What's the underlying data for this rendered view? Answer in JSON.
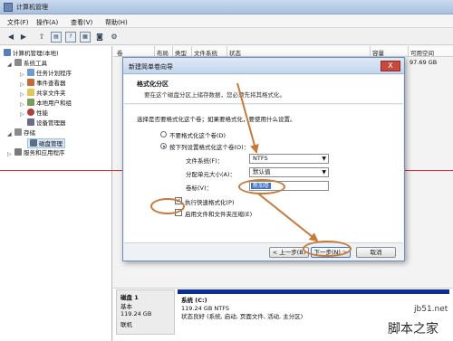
{
  "window": {
    "title": "计算机管理"
  },
  "menu": [
    "文件(F)",
    "操作(A)",
    "查看(V)",
    "帮助(H)"
  ],
  "tree": {
    "root": "计算机管理(本地)",
    "system_tools": "系统工具",
    "task_scheduler": "任务计划程序",
    "event_viewer": "事件查看器",
    "shared_folders": "共享文件夹",
    "local_users": "本地用户和组",
    "performance": "性能",
    "device_manager": "设备管理器",
    "storage": "存储",
    "disk_management": "磁盘管理",
    "services": "服务和应用程序"
  },
  "columns": [
    "卷",
    "布局",
    "类型",
    "文件系统",
    "状态",
    "容量",
    "可用空间"
  ],
  "capacity_value": "97.69 GB",
  "dialog": {
    "title": "新建简单卷向导",
    "close": "X",
    "header_title": "格式化分区",
    "header_sub": "要在这个磁盘分区上储存数据，您必须先将其格式化。",
    "prompt": "选择是否要格式化这个卷；如果要格式化，要使用什么设置。",
    "opt_noformat": "不要格式化这个卷(D)",
    "opt_format": "按下列设置格式化这个卷(O)：",
    "fs_label": "文件系统(F)：",
    "fs_value": "NTFS",
    "alloc_label": "分配单元大小(A)：",
    "alloc_value": "默认值",
    "volume_label": "卷标(V)：",
    "volume_value": "新加卷",
    "quick_format": "执行快速格式化(P)",
    "compress": "启用文件和文件夹压缩(E)",
    "btn_back": "< 上一步(B)",
    "btn_next": "下一步(N) >",
    "btn_cancel": "取消"
  },
  "disk": {
    "name": "磁盘 1",
    "type": "基本",
    "size": "119.24 GB",
    "status": "联机",
    "partition_name": "系统 (C:)",
    "partition_size": "119.24 GB NTFS",
    "partition_status": "状态良好 (系统, 启动, 页面文件, 活动, 主分区)"
  },
  "watermark": {
    "site": "jb51.net",
    "brand": "脚本之家"
  },
  "colors": {
    "annotation": "#c77a3a",
    "redline": "#e03030",
    "partition": "#0a2d9a"
  }
}
